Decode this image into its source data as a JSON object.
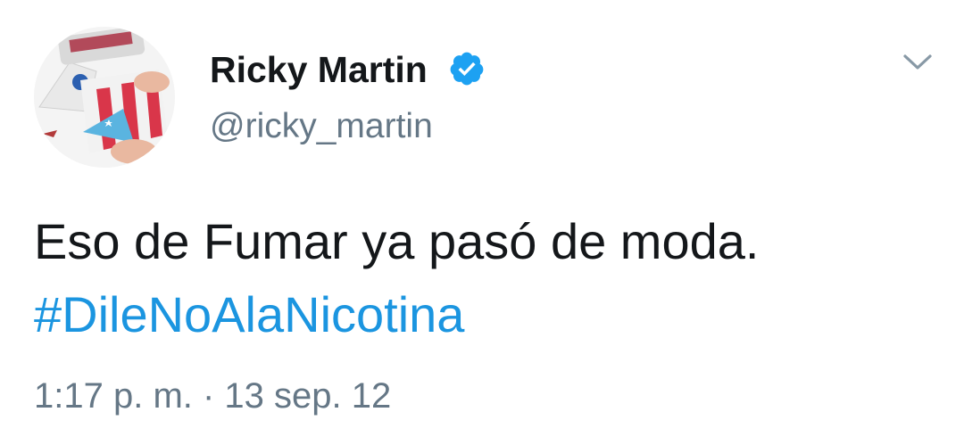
{
  "author": {
    "name": "Ricky Martin",
    "handle": "@ricky_martin",
    "verified": true
  },
  "tweet": {
    "text": "Eso de Fumar ya pasó de moda.",
    "hashtag": "#DileNoAlaNicotina",
    "timestamp": "1:17 p. m. · 13 sep. 12"
  },
  "icons": {
    "verified": "verified-badge-icon",
    "menu": "chevron-down-icon"
  },
  "colors": {
    "name": "#14171a",
    "secondary": "#657786",
    "link": "#1b95e0",
    "verified": "#1da1f2"
  }
}
